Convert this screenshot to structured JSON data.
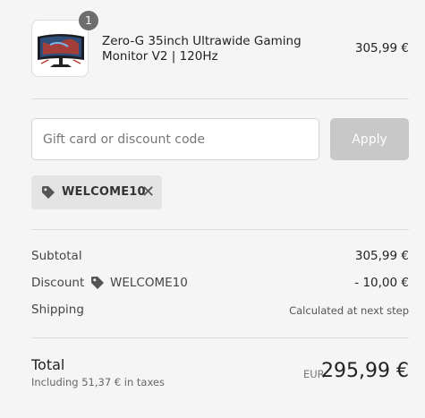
{
  "product": {
    "quantity": "1",
    "name": "Zero-G 35inch Ultrawide Gaming Monitor V2 | 120Hz",
    "price": "305,99 €"
  },
  "discount_form": {
    "placeholder": "Gift card or discount code",
    "value": "",
    "apply_label": "Apply"
  },
  "applied_code": {
    "code": "WELCOME10",
    "remove_glyph": "✕",
    "icon": "tag-icon"
  },
  "summary": {
    "subtotal_label": "Subtotal",
    "subtotal_value": "305,99 €",
    "discount_label": "Discount",
    "discount_code": "WELCOME10",
    "discount_value": "- 10,00 €",
    "shipping_label": "Shipping",
    "shipping_value": "Calculated at next step"
  },
  "total": {
    "label": "Total",
    "tax_note": "Including 51,37 € in taxes",
    "currency": "EUR",
    "value": "295,99 €"
  },
  "colors": {
    "background": "#f5f5f5",
    "apply_disabled": "#c8c8c8",
    "chip_background": "#e4e4e4",
    "badge": "#6d6d6d"
  }
}
